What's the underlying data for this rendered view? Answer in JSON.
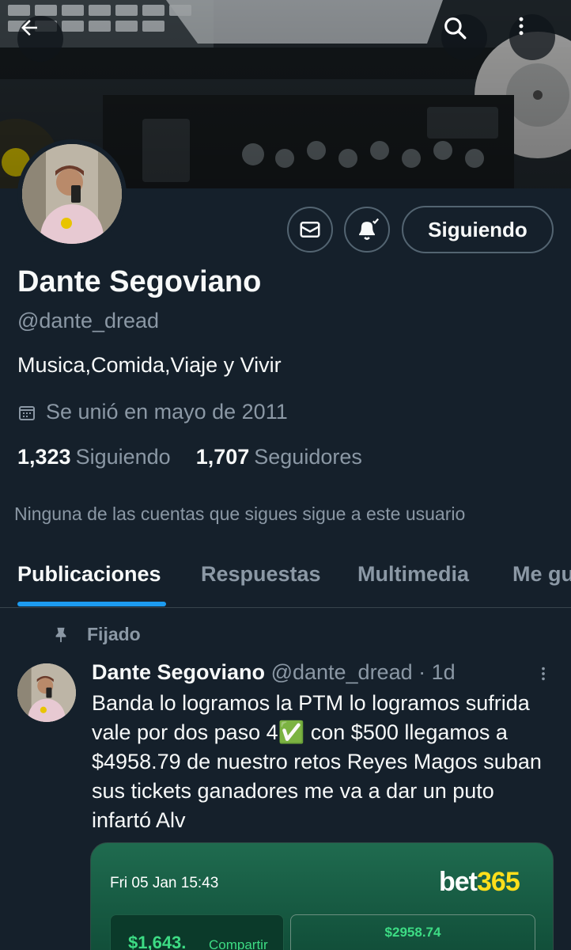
{
  "header": {
    "back_icon": "arrow-left-icon",
    "search_icon": "search-icon",
    "more_icon": "more-vertical-icon"
  },
  "profile": {
    "name": "Dante Segoviano",
    "handle": "@dante_dread",
    "bio": "Musica,Comida,Viaje y Vivir",
    "joined": "Se unió en mayo de 2011",
    "following_count": "1,323",
    "following_label": "Siguiendo",
    "followers_count": "1,707",
    "followers_label": "Seguidores",
    "mutual_note": "Ninguna de las cuentas que sigues sigue a este usuario",
    "follow_button_label": "Siguiendo"
  },
  "tabs": [
    {
      "label": "Publicaciones",
      "active": true
    },
    {
      "label": "Respuestas",
      "active": false
    },
    {
      "label": "Multimedia",
      "active": false
    },
    {
      "label": "Me gu",
      "active": false
    }
  ],
  "post": {
    "pinned_label": "Fijado",
    "author_name": "Dante Segoviano",
    "author_meta": "@dante_dread · 1d",
    "text": "Banda lo logramos la PTM lo logramos sufrida vale por dos paso 4✅ con $500 llegamos a $4958.79 de nuestro retos Reyes Magos suban sus tickets ganadores me va a dar un puto infartó Alv",
    "media": {
      "date": "Fri 05 Jan 15:43",
      "logo_main": "bet",
      "logo_accent": "365",
      "amount_1": "$1,643.",
      "share_label": "Compartir",
      "amount_2": "$2958.74"
    }
  },
  "colors": {
    "background": "#15202b",
    "accent": "#1d9bf0",
    "secondary_text": "#8b98a5",
    "border": "#536471"
  }
}
